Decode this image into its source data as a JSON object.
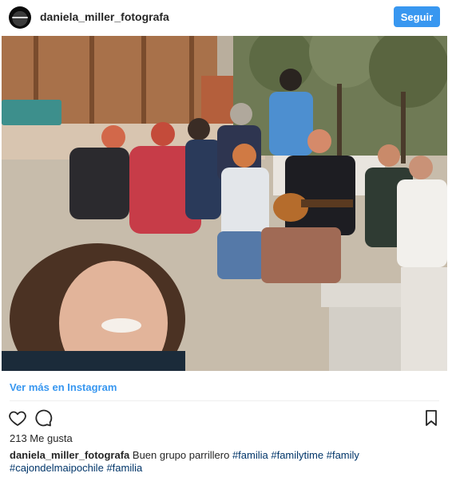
{
  "post": {
    "username": "daniela_miller_fotografa",
    "follow_label": "Seguir",
    "view_more_label": "Ver más en Instagram",
    "likes_text": "213 Me gusta",
    "caption": {
      "username": "daniela_miller_fotografa",
      "text": "Buen grupo parrillero",
      "hashtags": [
        "#familia",
        "#familytime",
        "#family",
        "#cajondelmaipochile",
        "#familia"
      ]
    }
  },
  "icons": {
    "avatar": "profile-avatar",
    "like": "heart-icon",
    "comment": "comment-icon",
    "save": "bookmark-icon"
  },
  "colors": {
    "accent": "#3897f0",
    "hashtag": "#003569",
    "text": "#262626"
  }
}
